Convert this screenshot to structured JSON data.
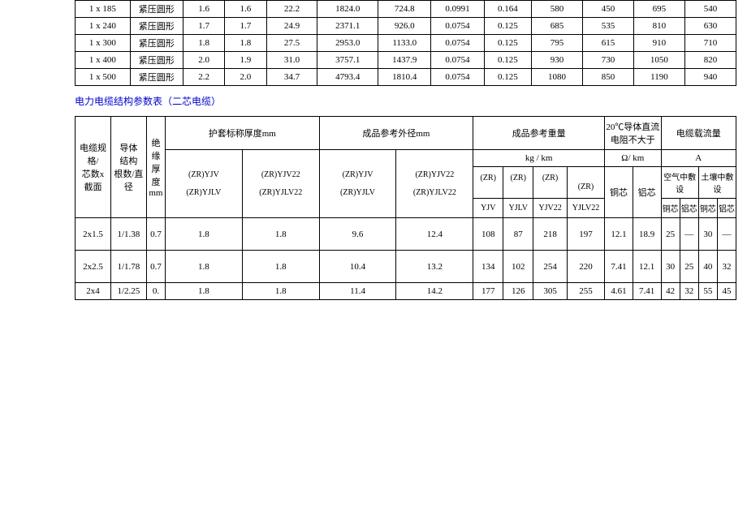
{
  "tbl1": {
    "rows": [
      {
        "spec": "1 x 185",
        "shape": "紧压圆形",
        "c1": "1.6",
        "c2": "1.6",
        "c3": "22.2",
        "c4": "1824.0",
        "c5": "724.8",
        "c6": "0.0991",
        "c7": "0.164",
        "c8": "580",
        "c9": "450",
        "c10": "695",
        "c11": "540"
      },
      {
        "spec": "1 x 240",
        "shape": "紧压圆形",
        "c1": "1.7",
        "c2": "1.7",
        "c3": "24.9",
        "c4": "2371.1",
        "c5": "926.0",
        "c6": "0.0754",
        "c7": "0.125",
        "c8": "685",
        "c9": "535",
        "c10": "810",
        "c11": "630"
      },
      {
        "spec": "1 x 300",
        "shape": "紧压圆形",
        "c1": "1.8",
        "c2": "1.8",
        "c3": "27.5",
        "c4": "2953.0",
        "c5": "1133.0",
        "c6": "0.0754",
        "c7": "0.125",
        "c8": "795",
        "c9": "615",
        "c10": "910",
        "c11": "710"
      },
      {
        "spec": "1 x 400",
        "shape": "紧压圆形",
        "c1": "2.0",
        "c2": "1.9",
        "c3": "31.0",
        "c4": "3757.1",
        "c5": "1437.9",
        "c6": "0.0754",
        "c7": "0.125",
        "c8": "930",
        "c9": "730",
        "c10": "1050",
        "c11": "820"
      },
      {
        "spec": "1 x 500",
        "shape": "紧压圆形",
        "c1": "2.2",
        "c2": "2.0",
        "c3": "34.7",
        "c4": "4793.4",
        "c5": "1810.4",
        "c6": "0.0754",
        "c7": "0.125",
        "c8": "1080",
        "c9": "850",
        "c10": "1190",
        "c11": "940"
      }
    ]
  },
  "title": "电力电缆结构参数表（二芯电缆）",
  "tbl2": {
    "headers": {
      "h1": "电缆规格/\n芯数x 截面",
      "h2": "导体\n结构\n根数/直径",
      "h3": "绝缘厚度\nmm",
      "h4": "护套标称厚度mm",
      "h5": "成品参考外径mm",
      "h6": "成品参考重量",
      "h7": "20℃导体直流电阻不大于",
      "h8": "电缆载流量",
      "h6u": "kg / km",
      "h7u": "Ω/ km",
      "h8u": "A",
      "zr": "(ZR)",
      "cu": "铜芯",
      "al": "铝芯",
      "air": "空气中敷设",
      "soil": "土壤中敷设",
      "p1": "(ZR)YJV",
      "p2": "(ZR)YJLV",
      "p3": "(ZR)YJV22",
      "p4": "(ZR)YJLV22",
      "p5": "(ZR)YJV",
      "p6": "(ZR)YJLV",
      "p7": "(ZR)YJV22",
      "p8": "(ZR)YJLV22",
      "w1": "YJV",
      "w2": "YJLV",
      "w3": "YJV22",
      "w4": "YJLV22"
    },
    "rows": [
      {
        "spec": "2x1.5",
        "cond": "1/1.38",
        "ins": "0.7",
        "h1": "1.8",
        "h2": "1.8",
        "d1": "9.6",
        "d2": "12.4",
        "w1": "108",
        "w2": "87",
        "w3": "218",
        "w4": "197",
        "r1": "12.1",
        "r2": "18.9",
        "a1": "25",
        "a2": "—",
        "a3": "30",
        "a4": "—"
      },
      {
        "spec": "2x2.5",
        "cond": "1/1.78",
        "ins": "0.7",
        "h1": "1.8",
        "h2": "1.8",
        "d1": "10.4",
        "d2": "13.2",
        "w1": "134",
        "w2": "102",
        "w3": "254",
        "w4": "220",
        "r1": "7.41",
        "r2": "12.1",
        "a1": "30",
        "a2": "25",
        "a3": "40",
        "a4": "32"
      },
      {
        "spec": "2x4",
        "cond": "1/2.25",
        "ins": "0.",
        "h1": "1.8",
        "h2": "1.8",
        "d1": "11.4",
        "d2": "14.2",
        "w1": "177",
        "w2": "126",
        "w3": "305",
        "w4": "255",
        "r1": "4.61",
        "r2": "7.41",
        "a1": "42",
        "a2": "32",
        "a3": "55",
        "a4": "45"
      }
    ]
  }
}
